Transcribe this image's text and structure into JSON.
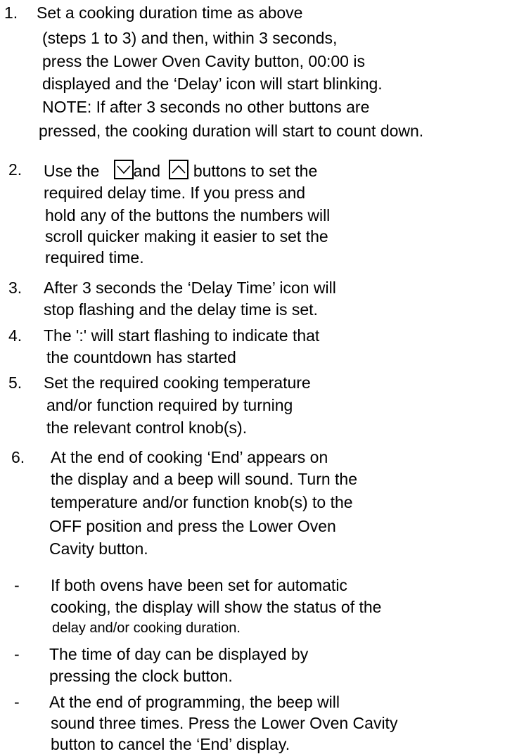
{
  "items": [
    {
      "number": "1.",
      "lines": [
        "Set a cooking duration time as above",
        "(steps 1 to 3) and then, within 3 seconds,",
        "press the Lower Oven Cavity button, 00:00 is",
        "displayed and the ‘Delay’ icon will start blinking.",
        "NOTE: If after 3 seconds no other buttons are",
        "pressed, the cooking duration will start to count down."
      ]
    },
    {
      "number": "2.",
      "line1": {
        "before": "Use the",
        "down_icon": "chevron-down-icon",
        "between": "and",
        "up_icon": "chevron-up-icon",
        "after": "buttons to set the"
      },
      "lines": [
        "required delay time. If you press and",
        "hold any of the buttons the numbers will",
        "scroll quicker making it easier to set the",
        "required time."
      ]
    },
    {
      "number": "3.",
      "lines": [
        "After 3 seconds the ‘Delay Time’ icon will",
        "stop flashing and the delay time is set."
      ]
    },
    {
      "number": "4.",
      "lines": [
        "The ':' will start flashing to indicate that",
        "the countdown has started"
      ]
    },
    {
      "number": "5.",
      "lines": [
        "Set the required cooking temperature",
        "and/or function required by turning",
        "the relevant control knob(s)."
      ]
    },
    {
      "number": "6.",
      "lines": [
        "At the end of cooking ‘End’ appears on",
        "the display and a beep will sound. Turn the",
        "temperature and/or function knob(s) to the",
        "OFF position and press the Lower Oven",
        "Cavity button."
      ]
    }
  ],
  "bullets": [
    {
      "marker": "-",
      "lines": [
        "If both ovens have been set for automatic",
        "cooking, the display will show the status of the",
        "delay and/or cooking duration."
      ]
    },
    {
      "marker": "-",
      "lines": [
        "The time of day can be displayed by",
        "pressing the clock button."
      ]
    },
    {
      "marker": "-",
      "lines": [
        "At the end of programming, the beep will",
        "sound three times. Press the Lower Oven Cavity",
        "button to cancel the ‘End’ display."
      ]
    }
  ]
}
